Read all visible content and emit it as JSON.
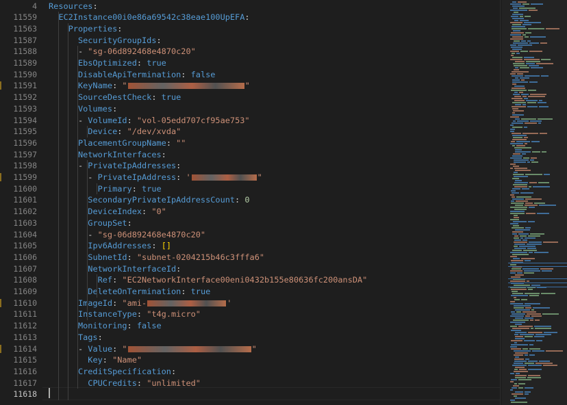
{
  "editor": {
    "current_line": "11618",
    "lines": [
      {
        "num": "4",
        "parts": [
          [
            "k",
            "Resources"
          ],
          [
            "p",
            ":"
          ]
        ]
      },
      {
        "num": "11559",
        "parts": [
          [
            "p",
            "  "
          ],
          [
            "k",
            "EC2Instance00i0e86a69542c38eae100UpEFA"
          ],
          [
            "p",
            ":"
          ]
        ]
      },
      {
        "num": "11563",
        "parts": [
          [
            "p",
            "    "
          ],
          [
            "k",
            "Properties"
          ],
          [
            "p",
            ":"
          ]
        ]
      },
      {
        "num": "11587",
        "parts": [
          [
            "p",
            "      "
          ],
          [
            "k",
            "SecurityGroupIds"
          ],
          [
            "p",
            ":"
          ]
        ]
      },
      {
        "num": "11588",
        "parts": [
          [
            "p",
            "      - "
          ],
          [
            "s",
            "\"sg-06d892468e4870c20\""
          ]
        ]
      },
      {
        "num": "11589",
        "parts": [
          [
            "p",
            "      "
          ],
          [
            "k",
            "EbsOptimized"
          ],
          [
            "p",
            ": "
          ],
          [
            "b",
            "true"
          ]
        ]
      },
      {
        "num": "11590",
        "parts": [
          [
            "p",
            "      "
          ],
          [
            "k",
            "DisableApiTermination"
          ],
          [
            "p",
            ": "
          ],
          [
            "b",
            "false"
          ]
        ]
      },
      {
        "num": "11591",
        "parts": [
          [
            "p",
            "      "
          ],
          [
            "k",
            "KeyName"
          ],
          [
            "p",
            ": "
          ],
          [
            "s",
            "\""
          ],
          [
            "r",
            "170"
          ],
          [
            "s",
            "\""
          ]
        ]
      },
      {
        "num": "11592",
        "parts": [
          [
            "p",
            "      "
          ],
          [
            "k",
            "SourceDestCheck"
          ],
          [
            "p",
            ": "
          ],
          [
            "b",
            "true"
          ]
        ]
      },
      {
        "num": "11593",
        "parts": [
          [
            "p",
            "      "
          ],
          [
            "k",
            "Volumes"
          ],
          [
            "p",
            ":"
          ]
        ]
      },
      {
        "num": "11594",
        "parts": [
          [
            "p",
            "      - "
          ],
          [
            "k",
            "VolumeId"
          ],
          [
            "p",
            ": "
          ],
          [
            "s",
            "\"vol-05edd707cf95ae753\""
          ]
        ]
      },
      {
        "num": "11595",
        "parts": [
          [
            "p",
            "        "
          ],
          [
            "k",
            "Device"
          ],
          [
            "p",
            ": "
          ],
          [
            "s",
            "\"/dev/xvda\""
          ]
        ]
      },
      {
        "num": "11596",
        "parts": [
          [
            "p",
            "      "
          ],
          [
            "k",
            "PlacementGroupName"
          ],
          [
            "p",
            ": "
          ],
          [
            "s",
            "\"\""
          ]
        ]
      },
      {
        "num": "11597",
        "parts": [
          [
            "p",
            "      "
          ],
          [
            "k",
            "NetworkInterfaces"
          ],
          [
            "p",
            ":"
          ]
        ]
      },
      {
        "num": "11598",
        "parts": [
          [
            "p",
            "      - "
          ],
          [
            "k",
            "PrivateIpAddresses"
          ],
          [
            "p",
            ":"
          ]
        ]
      },
      {
        "num": "11599",
        "parts": [
          [
            "p",
            "        - "
          ],
          [
            "k",
            "PrivateIpAddress"
          ],
          [
            "p",
            ": "
          ],
          [
            "s",
            "'"
          ],
          [
            "r",
            "95"
          ],
          [
            "s",
            "\""
          ]
        ]
      },
      {
        "num": "11600",
        "parts": [
          [
            "p",
            "          "
          ],
          [
            "k",
            "Primary"
          ],
          [
            "p",
            ": "
          ],
          [
            "b",
            "true"
          ]
        ]
      },
      {
        "num": "11601",
        "parts": [
          [
            "p",
            "        "
          ],
          [
            "k",
            "SecondaryPrivateIpAddressCount"
          ],
          [
            "p",
            ": "
          ],
          [
            "n",
            "0"
          ]
        ]
      },
      {
        "num": "11602",
        "parts": [
          [
            "p",
            "        "
          ],
          [
            "k",
            "DeviceIndex"
          ],
          [
            "p",
            ": "
          ],
          [
            "s",
            "\"0\""
          ]
        ]
      },
      {
        "num": "11603",
        "parts": [
          [
            "p",
            "        "
          ],
          [
            "k",
            "GroupSet"
          ],
          [
            "p",
            ":"
          ]
        ]
      },
      {
        "num": "11604",
        "parts": [
          [
            "p",
            "        - "
          ],
          [
            "s",
            "\"sg-06d892468e4870c20\""
          ]
        ]
      },
      {
        "num": "11605",
        "parts": [
          [
            "p",
            "        "
          ],
          [
            "k",
            "Ipv6Addresses"
          ],
          [
            "p",
            ": "
          ],
          [
            "y",
            "[]"
          ]
        ]
      },
      {
        "num": "11606",
        "parts": [
          [
            "p",
            "        "
          ],
          [
            "k",
            "SubnetId"
          ],
          [
            "p",
            ": "
          ],
          [
            "s",
            "\"subnet-0204215b46c3fffa6\""
          ]
        ]
      },
      {
        "num": "11607",
        "parts": [
          [
            "p",
            "        "
          ],
          [
            "k",
            "NetworkInterfaceId"
          ],
          [
            "p",
            ":"
          ]
        ]
      },
      {
        "num": "11608",
        "parts": [
          [
            "p",
            "          "
          ],
          [
            "k",
            "Ref"
          ],
          [
            "p",
            ": "
          ],
          [
            "s",
            "\"EC2NetworkInterface00eni0432b155e80636fc200ansDA\""
          ]
        ]
      },
      {
        "num": "11609",
        "parts": [
          [
            "p",
            "        "
          ],
          [
            "k",
            "DeleteOnTermination"
          ],
          [
            "p",
            ": "
          ],
          [
            "b",
            "true"
          ]
        ]
      },
      {
        "num": "11610",
        "parts": [
          [
            "p",
            "      "
          ],
          [
            "k",
            "ImageId"
          ],
          [
            "p",
            ": "
          ],
          [
            "s",
            "\"ami-"
          ],
          [
            "r",
            "115"
          ],
          [
            "s",
            "'"
          ]
        ]
      },
      {
        "num": "11611",
        "parts": [
          [
            "p",
            "      "
          ],
          [
            "k",
            "InstanceType"
          ],
          [
            "p",
            ": "
          ],
          [
            "s",
            "\"t4g.micro\""
          ]
        ]
      },
      {
        "num": "11612",
        "parts": [
          [
            "p",
            "      "
          ],
          [
            "k",
            "Monitoring"
          ],
          [
            "p",
            ": "
          ],
          [
            "b",
            "false"
          ]
        ]
      },
      {
        "num": "11613",
        "parts": [
          [
            "p",
            "      "
          ],
          [
            "k",
            "Tags"
          ],
          [
            "p",
            ":"
          ]
        ]
      },
      {
        "num": "11614",
        "parts": [
          [
            "p",
            "      - "
          ],
          [
            "k",
            "Value"
          ],
          [
            "p",
            ": "
          ],
          [
            "s",
            "\""
          ],
          [
            "r",
            "180"
          ],
          [
            "s",
            "\""
          ]
        ]
      },
      {
        "num": "11615",
        "parts": [
          [
            "p",
            "        "
          ],
          [
            "k",
            "Key"
          ],
          [
            "p",
            ": "
          ],
          [
            "s",
            "\"Name\""
          ]
        ]
      },
      {
        "num": "11616",
        "parts": [
          [
            "p",
            "      "
          ],
          [
            "k",
            "CreditSpecification"
          ],
          [
            "p",
            ":"
          ]
        ]
      },
      {
        "num": "11617",
        "parts": [
          [
            "p",
            "        "
          ],
          [
            "k",
            "CPUCredits"
          ],
          [
            "p",
            ": "
          ],
          [
            "s",
            "\"unlimited\""
          ]
        ]
      },
      {
        "num": "11618",
        "parts": []
      }
    ]
  },
  "colors": {
    "background": "#1e1e1e",
    "key": "#569cd6",
    "string": "#ce9178",
    "number": "#b5cea8",
    "bracket": "#ffd700",
    "line_number": "#858585"
  }
}
